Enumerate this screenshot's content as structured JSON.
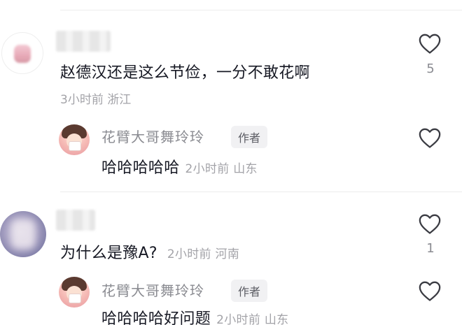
{
  "comments": [
    {
      "text": "赵德汉还是这么节俭，一分不敢花啊",
      "meta": "3小时前 浙江",
      "likes": "5",
      "reply": {
        "author": "花臂大哥舞玲玲",
        "badge": "作者",
        "text": "哈哈哈哈哈",
        "meta": "2小时前 山东"
      }
    },
    {
      "text": "为什么是豫A?",
      "meta": "2小时前 河南",
      "likes": "1",
      "reply": {
        "author": "花臂大哥舞玲玲",
        "badge": "作者",
        "text": "哈哈哈哈好问题",
        "meta": "2小时前 山东"
      }
    }
  ],
  "icons": {
    "like": "heart-outline-icon"
  },
  "colors": {
    "text": "#161823",
    "meta": "#a3a3a8",
    "name": "#8a8b91",
    "badge_bg": "#f1f1f3"
  }
}
